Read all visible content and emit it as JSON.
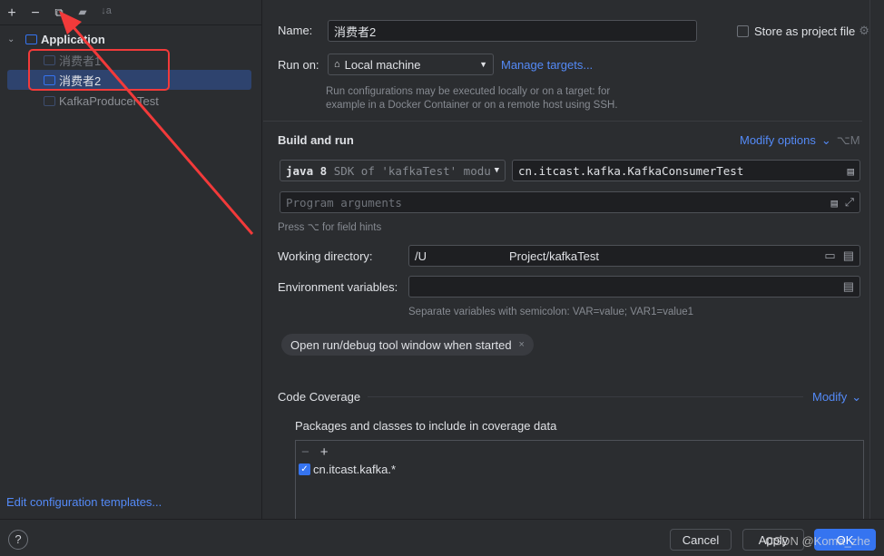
{
  "toolbar": {
    "add": "+",
    "remove": "−",
    "copy": "⧉",
    "folder": "▰",
    "sort": "↓a"
  },
  "tree": {
    "group": "Application",
    "items": [
      "消费者1",
      "消费者2",
      "KafkaProducerTest"
    ]
  },
  "left_footer": {
    "templates_link": "Edit configuration templates...",
    "help": "?"
  },
  "form": {
    "name_label": "Name:",
    "name_value": "消费者2",
    "store_label": "Store as project file",
    "run_on_label": "Run on:",
    "run_on_value": "Local machine",
    "manage_targets": "Manage targets...",
    "run_on_hint": "Run configurations may be executed locally or on a target: for example in a Docker Container or on a remote host using SSH.",
    "build_title": "Build and run",
    "modify_options": "Modify options",
    "modify_shortcut": "⌥M",
    "jdk_bold": "java 8",
    "jdk_rest": "SDK of 'kafkaTest' modu",
    "main_class": "cn.itcast.kafka.KafkaConsumerTest",
    "program_args_placeholder": "Program arguments",
    "field_hints": "Press ⌥ for field hints",
    "workdir_label": "Working directory:",
    "workdir_value": "/U       Project/kafkaTest",
    "env_label": "Environment variables:",
    "env_hint": "Separate variables with semicolon: VAR=value; VAR1=value1",
    "chip": "Open run/debug tool window when started",
    "coverage_title": "Code Coverage",
    "coverage_modify": "Modify",
    "coverage_sub": "Packages and classes to include in coverage data",
    "coverage_items": [
      "cn.itcast.kafka.*"
    ]
  },
  "footer": {
    "cancel": "Cancel",
    "apply": "Apply",
    "ok": "OK",
    "watermark": "CSDN @Koma_zhe"
  },
  "colors": {
    "accent": "#3574f0",
    "annotation": "#f23a3a"
  }
}
